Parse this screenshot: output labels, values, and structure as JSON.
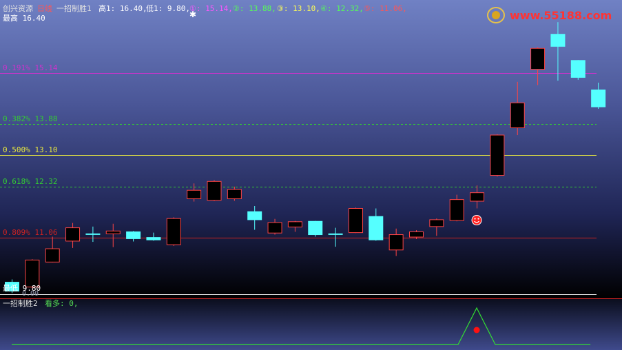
{
  "header": {
    "stock_name": "创兴资源",
    "period": "日线",
    "indicator": "一招制胜1",
    "high_label": "高1: 16.40,",
    "low_label": "低1: 9.80,",
    "l1": "①: 15.14,",
    "l2": "②: 13.88,",
    "l3": "③: 13.10,",
    "l4": "④: 12.32,",
    "l5": "⑤: 11.06,"
  },
  "main_labels": {
    "highest": "最高 16.40",
    "lowest": "最低 9.80",
    "lowest_overlap": "0.00"
  },
  "levels": [
    {
      "label": "0.191%  15.14",
      "value": 15.14,
      "color": "#cc33cc",
      "dashed": false
    },
    {
      "label": "0.382%  13.88",
      "value": 13.88,
      "color": "#33cc33",
      "dashed": true
    },
    {
      "label": "0.500%  13.10",
      "value": 13.1,
      "color": "#e6e640",
      "dashed": false
    },
    {
      "label": "0.618%  12.32",
      "value": 12.32,
      "color": "#33cc33",
      "dashed": true
    },
    {
      "label": "0.809%  11.06",
      "value": 11.06,
      "color": "#cc2222",
      "dashed": false
    }
  ],
  "sub_panel": {
    "title": "一招制胜2",
    "series_label": "看多: 0,"
  },
  "logo": {
    "text": "www.55188.com"
  },
  "colors": {
    "up": "#ff4444",
    "down": "#55ffff",
    "text": "#ffffff"
  },
  "chart_data": {
    "type": "candlestick",
    "ylim": [
      9.55,
      16.95
    ],
    "candles": [
      {
        "o": 9.95,
        "c": 9.73,
        "h": 10.02,
        "l": 9.68
      },
      {
        "o": 9.83,
        "c": 10.5,
        "h": 10.52,
        "l": 9.8
      },
      {
        "o": 10.45,
        "c": 10.78,
        "h": 11.08,
        "l": 10.44
      },
      {
        "o": 10.97,
        "c": 11.3,
        "h": 11.42,
        "l": 10.8
      },
      {
        "o": 11.15,
        "c": 11.14,
        "h": 11.33,
        "l": 10.95
      },
      {
        "o": 11.15,
        "c": 11.22,
        "h": 11.4,
        "l": 10.82
      },
      {
        "o": 11.2,
        "c": 11.03,
        "h": 11.22,
        "l": 10.96
      },
      {
        "o": 11.06,
        "c": 11.0,
        "h": 11.18,
        "l": 10.98
      },
      {
        "o": 10.88,
        "c": 11.53,
        "h": 11.56,
        "l": 10.85
      },
      {
        "o": 12.02,
        "c": 12.23,
        "h": 12.4,
        "l": 11.95
      },
      {
        "o": 11.98,
        "c": 12.45,
        "h": 12.48,
        "l": 11.96
      },
      {
        "o": 12.02,
        "c": 12.25,
        "h": 12.32,
        "l": 11.97
      },
      {
        "o": 11.7,
        "c": 11.5,
        "h": 11.84,
        "l": 11.25
      },
      {
        "o": 11.17,
        "c": 11.43,
        "h": 11.52,
        "l": 11.13
      },
      {
        "o": 11.32,
        "c": 11.45,
        "h": 11.47,
        "l": 11.2
      },
      {
        "o": 11.46,
        "c": 11.13,
        "h": 11.47,
        "l": 11.08
      },
      {
        "o": 11.15,
        "c": 11.14,
        "h": 11.3,
        "l": 10.83
      },
      {
        "o": 11.18,
        "c": 11.78,
        "h": 11.8,
        "l": 11.17
      },
      {
        "o": 11.58,
        "c": 11.0,
        "h": 11.78,
        "l": 10.98
      },
      {
        "o": 10.75,
        "c": 11.13,
        "h": 11.28,
        "l": 10.6
      },
      {
        "o": 11.07,
        "c": 11.2,
        "h": 11.24,
        "l": 11.02
      },
      {
        "o": 11.33,
        "c": 11.5,
        "h": 11.53,
        "l": 11.1
      },
      {
        "o": 11.48,
        "c": 12.0,
        "h": 12.12,
        "l": 11.46
      },
      {
        "o": 11.96,
        "c": 12.17,
        "h": 12.35,
        "l": 11.78
      },
      {
        "o": 12.6,
        "c": 13.6,
        "h": 13.62,
        "l": 12.57
      },
      {
        "o": 13.78,
        "c": 14.4,
        "h": 14.92,
        "l": 13.6
      },
      {
        "o": 15.23,
        "c": 15.75,
        "h": 15.78,
        "l": 14.84
      },
      {
        "o": 16.1,
        "c": 15.8,
        "h": 16.4,
        "l": 14.95
      },
      {
        "o": 15.45,
        "c": 15.03,
        "h": 15.46,
        "l": 14.97
      },
      {
        "o": 14.72,
        "c": 14.3,
        "h": 14.9,
        "l": 14.25
      }
    ],
    "signal_index": 23,
    "signal_series": [
      0,
      0,
      0,
      0,
      0,
      0,
      0,
      0,
      0,
      0,
      0,
      0,
      0,
      0,
      0,
      0,
      0,
      0,
      0,
      0,
      0,
      0,
      0,
      1,
      0,
      0,
      0,
      0,
      0,
      0
    ]
  }
}
